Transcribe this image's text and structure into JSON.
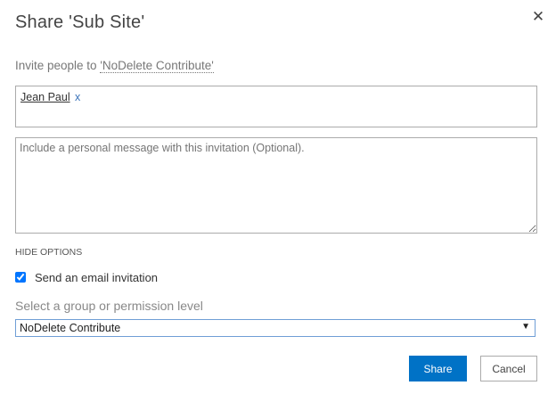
{
  "dialog": {
    "title": "Share 'Sub Site'",
    "close_icon": "close-icon",
    "invite_prefix": "Invite people to ",
    "invite_group": "'NoDelete Contribute'",
    "people": [
      {
        "name": "Jean Paul",
        "remove": "x"
      }
    ],
    "message_placeholder": "Include a personal message with this invitation (Optional).",
    "hide_options": "HIDE OPTIONS",
    "send_email_label": "Send an email invitation",
    "send_email_checked": true,
    "select_label": "Select a group or permission level",
    "select_value": "NoDelete Contribute",
    "select_arrow": "▼",
    "share_label": "Share",
    "cancel_label": "Cancel",
    "accent_color": "#0072c6"
  }
}
